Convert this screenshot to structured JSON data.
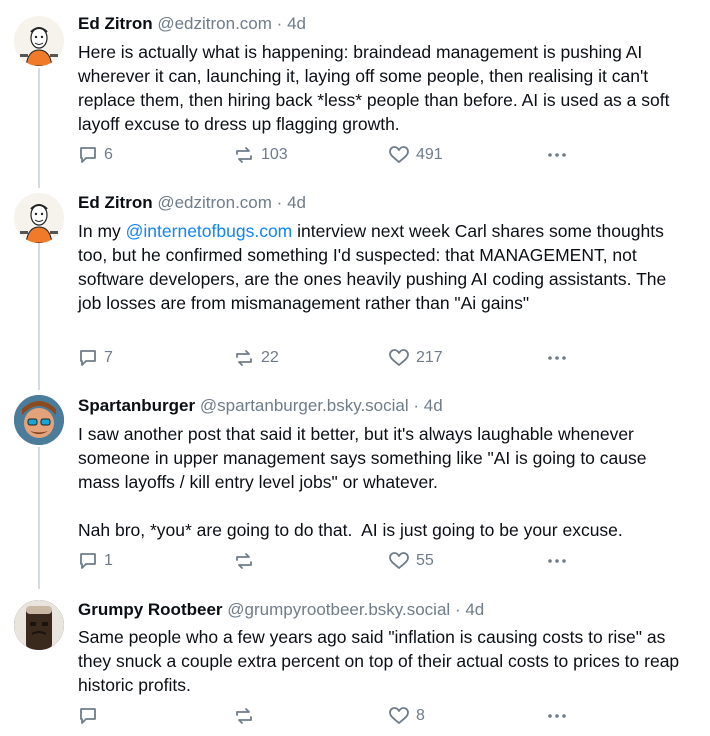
{
  "posts": [
    {
      "name": "Ed Zitron",
      "handle": "@edzitron.com",
      "time": "4d",
      "text": "Here is actually what is happening: braindead management is pushing AI wherever it can, launching it, laying off some people, then realising it can't replace them, then hiring back *less* people than before. AI is used as a soft layoff excuse to dress up flagging growth.",
      "replies": "6",
      "reposts": "103",
      "likes": "491"
    },
    {
      "name": "Ed Zitron",
      "handle": "@edzitron.com",
      "time": "4d",
      "text_before": "In my ",
      "mention": "@internetofbugs.com",
      "text_after": " interview next week Carl shares some thoughts too, but he confirmed something I'd suspected: that MANAGEMENT, not software developers, are the ones heavily pushing AI coding assistants. The job losses are from mismanagement rather than \"Ai gains\"",
      "replies": "7",
      "reposts": "22",
      "likes": "217"
    },
    {
      "name": "Spartanburger",
      "handle": "@spartanburger.bsky.social",
      "time": "4d",
      "text": "I saw another post that said it better, but it's always laughable whenever someone in upper management says something like \"AI is going to cause mass layoffs / kill entry level jobs\" or whatever.\n\nNah bro, *you* are going to do that.  AI is just going to be your excuse.",
      "replies": "1",
      "reposts": "",
      "likes": "55"
    },
    {
      "name": "Grumpy Rootbeer",
      "handle": "@grumpyrootbeer.bsky.social",
      "time": "4d",
      "text": "Same people who a few years ago said \"inflation is causing costs to rise\" as they snuck a couple extra percent on top of their actual costs to prices to reap historic profits.",
      "replies": "",
      "reposts": "",
      "likes": "8"
    }
  ],
  "separator": "·",
  "colors": {
    "text": "#0b0f14",
    "muted": "#6f7c89",
    "link": "#1083fe",
    "thread": "#d4dbe2"
  },
  "icons": [
    "reply-icon",
    "repost-icon",
    "like-icon",
    "more-icon"
  ]
}
